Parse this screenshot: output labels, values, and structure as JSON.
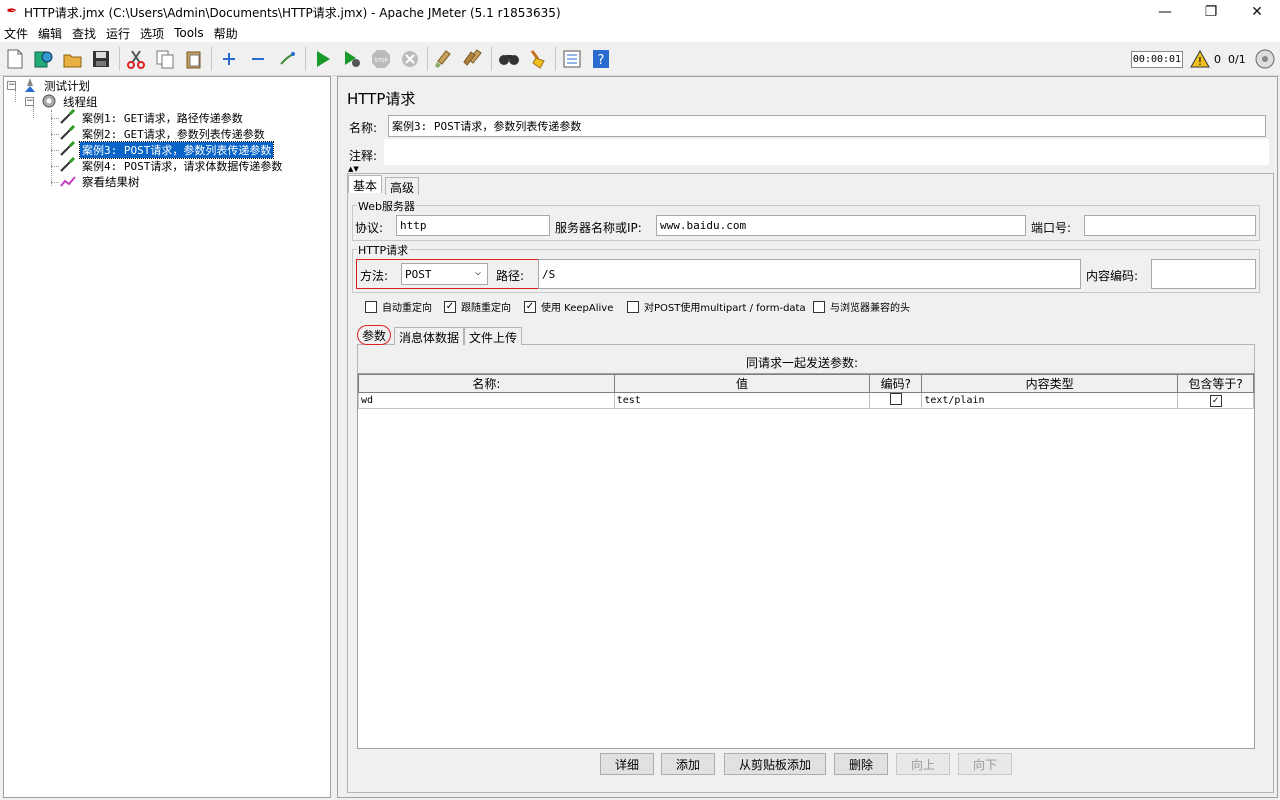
{
  "window": {
    "title": "HTTP请求.jmx (C:\\Users\\Admin\\Documents\\HTTP请求.jmx) - Apache JMeter (5.1 r1853635)",
    "controls": [
      "—",
      "❐",
      "✕"
    ]
  },
  "menu": [
    "文件",
    "编辑",
    "查找",
    "运行",
    "选项",
    "Tools",
    "帮助"
  ],
  "toolbar": {
    "icons": [
      "new-icon",
      "templates-icon",
      "open-icon",
      "save-icon",
      "cut-icon",
      "copy-icon",
      "paste-icon",
      "expand-icon",
      "collapse-icon",
      "toggle-icon",
      "start-icon",
      "start-no-pause-icon",
      "stop-icon",
      "shutdown-icon",
      "clear-icon",
      "clear-all-icon",
      "search-icon",
      "reset-search-icon",
      "function-helper-icon",
      "help-icon"
    ],
    "timer": "00:00:01",
    "warnings": "0",
    "threads": "0/1"
  },
  "tree": {
    "test_plan": "测试计划",
    "thread_group": "线程组",
    "items": [
      "案例1: GET请求，路径传递参数",
      "案例2: GET请求，参数列表传递参数",
      "案例3: POST请求，参数列表传递参数",
      "案例4: POST请求，请求体数据传递参数"
    ],
    "listener": "察看结果树",
    "selected_index": 2
  },
  "panel": {
    "title": "HTTP请求",
    "name_label": "名称:",
    "name_value": "案例3: POST请求，参数列表传递参数",
    "comment_label": "注释:",
    "comment_value": "",
    "tabs": [
      "基本",
      "高级"
    ],
    "web_server": {
      "legend": "Web服务器",
      "protocol_label": "协议:",
      "protocol_value": "http",
      "server_label": "服务器名称或IP:",
      "server_value": "www.baidu.com",
      "port_label": "端口号:",
      "port_value": ""
    },
    "http_request": {
      "legend": "HTTP请求",
      "method_label": "方法:",
      "method_value": "POST",
      "path_label": "路径:",
      "path_value": "/S",
      "encoding_label": "内容编码:",
      "encoding_value": ""
    },
    "options": [
      {
        "label": "自动重定向",
        "checked": false
      },
      {
        "label": "跟随重定向",
        "checked": true
      },
      {
        "label": "使用 KeepAlive",
        "checked": true
      },
      {
        "label": "对POST使用multipart / form-data",
        "checked": false
      },
      {
        "label": "与浏览器兼容的头",
        "checked": false
      }
    ],
    "sub_tabs": [
      "参数",
      "消息体数据",
      "文件上传"
    ],
    "params_caption": "同请求一起发送参数:",
    "columns": [
      "名称:",
      "值",
      "编码?",
      "内容类型",
      "包含等于?"
    ],
    "rows": [
      {
        "name": "wd",
        "value": "test",
        "encode": false,
        "content_type": "text/plain",
        "include_equals": true
      }
    ],
    "buttons": [
      {
        "label": "详细",
        "enabled": true
      },
      {
        "label": "添加",
        "enabled": true
      },
      {
        "label": "从剪贴板添加",
        "enabled": true
      },
      {
        "label": "删除",
        "enabled": true
      },
      {
        "label": "向上",
        "enabled": false
      },
      {
        "label": "向下",
        "enabled": false
      }
    ]
  }
}
